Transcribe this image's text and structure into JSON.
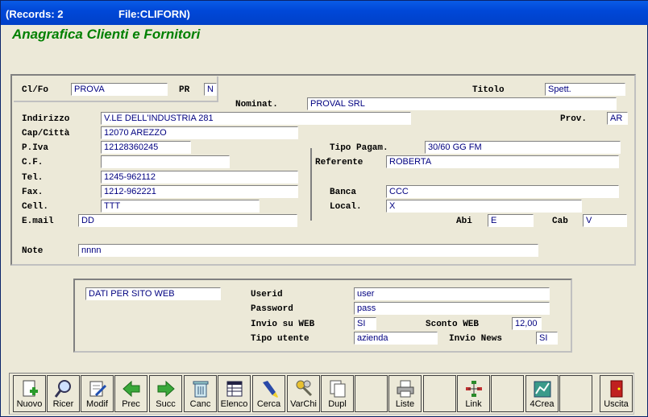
{
  "titlebar": {
    "records": "(Records: 2",
    "file": "File:CLIFORN)"
  },
  "app_title": "Anagrafica Clienti e Fornitori",
  "form": {
    "clfo": {
      "label": "Cl/Fo",
      "value": "PROVA"
    },
    "pr": {
      "label": "PR",
      "value": "N"
    },
    "titolo": {
      "label": "Titolo",
      "value": "Spett."
    },
    "nominat": {
      "label": "Nominat.",
      "value": "PROVAL SRL"
    },
    "indirizzo": {
      "label": "Indirizzo",
      "value": "V.LE DELL'INDUSTRIA 281"
    },
    "prov": {
      "label": "Prov.",
      "value": "AR"
    },
    "cap": {
      "label": "Cap/Città",
      "value": "12070 AREZZO"
    },
    "piva": {
      "label": "P.Iva",
      "value": "12128360245"
    },
    "cf": {
      "label": "C.F.",
      "value": ""
    },
    "tel": {
      "label": "Tel.",
      "value": "1245-962112"
    },
    "fax": {
      "label": "Fax.",
      "value": "1212-962221"
    },
    "cell": {
      "label": "Cell.",
      "value": "TTT"
    },
    "email": {
      "label": "E.mail",
      "value": "DD"
    },
    "tipo_pagam": {
      "label": "Tipo Pagam.",
      "value": "30/60 GG FM"
    },
    "referente": {
      "label": "Referente",
      "value": "ROBERTA"
    },
    "banca": {
      "label": "Banca",
      "value": "CCC"
    },
    "local": {
      "label": "Local.",
      "value": "X"
    },
    "abi": {
      "label": "Abi",
      "value": "E"
    },
    "cab": {
      "label": "Cab",
      "value": "V"
    },
    "note": {
      "label": "Note",
      "value": "nnnn"
    }
  },
  "web": {
    "title_value": "DATI PER SITO WEB",
    "userid": {
      "label": "Userid",
      "value": "user"
    },
    "password": {
      "label": "Password",
      "value": "pass"
    },
    "invio_web": {
      "label": "Invio su WEB",
      "value": "SI"
    },
    "sconto_web": {
      "label": "Sconto WEB",
      "value": "12,00"
    },
    "tipo_utente": {
      "label": "Tipo utente",
      "value": "azienda"
    },
    "invio_news": {
      "label": "Invio News",
      "value": "SI"
    }
  },
  "toolbar": {
    "nuovo": "Nuovo",
    "ricer": "Ricer",
    "modif": "Modif",
    "prec": "Prec",
    "succ": "Succ",
    "canc": "Canc",
    "elenco": "Elenco",
    "cerca": "Cerca",
    "varchi": "VarChi",
    "dupl": "Dupl",
    "liste": "Liste",
    "link": "Link",
    "crea": "4Crea",
    "uscita": "Uscita"
  },
  "colors": {
    "title_green": "#008000",
    "field_text": "#000080",
    "titlebar": "#0048d8"
  }
}
